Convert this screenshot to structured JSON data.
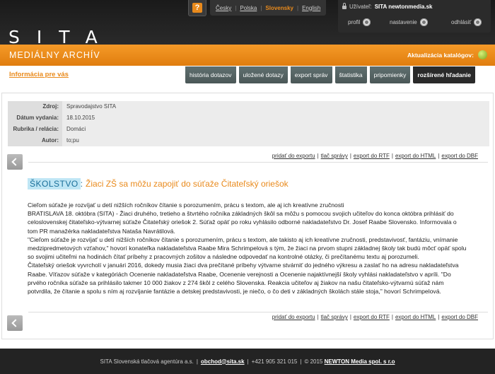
{
  "header": {
    "logo": "SITA",
    "help_label": "?",
    "languages": [
      {
        "label": "Česky",
        "active": false
      },
      {
        "label": "Polska",
        "active": false
      },
      {
        "label": "Slovensky",
        "active": true
      },
      {
        "label": "English",
        "active": false
      }
    ],
    "user_label": "Užívateľ:",
    "user_name": "SITA newtonmedia.sk",
    "profile_label": "profil",
    "settings_label": "nastavenie",
    "logout_label": "odhlásiť"
  },
  "banner": {
    "title": "MEDIÁLNY ARCHÍV",
    "update_label": "Aktualizácia katalógov:",
    "status_color": "#8fbc1f"
  },
  "info_link": "Informácia pre vás",
  "tabs": [
    {
      "label": "história dotazov"
    },
    {
      "label": "uložené dotazy"
    },
    {
      "label": "export správ"
    },
    {
      "label": "štatistika"
    },
    {
      "label": "pripomienky"
    },
    {
      "label": "rozšírené hľadanie",
      "active": true
    }
  ],
  "meta": [
    {
      "key": "Zdroj:",
      "value": "Spravodajstvo SITA"
    },
    {
      "key": "Dátum vydania:",
      "value": "18.10.2015"
    },
    {
      "key": "Rubrika / relácia:",
      "value": "Domáci"
    },
    {
      "key": "Autor:",
      "value": "to;pu"
    }
  ],
  "actions": {
    "add_export": "pridať do exportu",
    "print": "tlač správy",
    "export_rtf": "export do RTF",
    "export_html": "export do HTML",
    "export_dbf": "export do DBF"
  },
  "article": {
    "rubric": "ŠKOLSTVO",
    "colon": ":",
    "title": "Žiaci ZŠ sa môžu zapojiť do súťaže Čitateľský oriešok",
    "paragraphs": [
      "Cieľom súťaže je rozvíjať u detí nižších ročníkov čítanie s porozumením, prácu s textom, ale aj ich kreatívne zručnosti",
      "BRATISLAVA 18. októbra (SITA) - Žiaci druhého, tretieho a štvrtého ročníka základných škôl sa môžu s pomocou svojich učiteľov do konca októbra prihlásiť do celoslovenskej čitateľsko-výtvarnej súťaže Čitateľský oriešok 2. Súťaž opäť po roku vyhlásilo odborné nakladateľstvo Dr. Josef Raabe Slovensko. Informovala o tom PR manažérka nakladateľstva Nataša Navrátilová.",
      "\"Cieľom súťaže je rozvíjať u detí nižších ročníkov čítanie s porozumením, prácu s textom, ale takisto aj ich kreatívne zručnosti, predstavivosť, fantáziu, vnímanie medzipredmetových vzťahov,\" hovorí konateľka nakladateľstva Raabe Mira Schrimpelová s tým, že žiaci na prvom stupni základnej školy tak budú môcť opäť spolu so svojimi učiteľmi na hodinách čítať príbehy z pracovných zošitov a následne odpovedať na kontrolné otázky, či prečítanému textu aj porozumeli.",
      "Čitateľský oriešok vyvrcholí v januári 2016, dokedy musia žiaci dva prečítané príbehy výtvarne stvárniť do jedného výkresu a zaslať ho na adresu nakladateľstva Raabe. Víťazov súťaže v kategóriách Ocenenie nakladateľstva Raabe, Ocenenie verejnosti a Ocenenie najaktívnejší školy vyhlási nakladateľstvo v apríli. \"Do prvého ročníka súťaže sa prihlásilo takmer 10 000 žiakov z 274 škôl z celého Slovenska. Reakcia učiteľov aj žiakov na našu čitateľsko-výtvarnú súťaž nám potvrdila, že čítanie a spolu s ním aj rozvíjanie fantázie a detskej predstavivosti, je niečo, o čo deti v základných školách stále stoja,\" hovorí Schrimpelová."
    ]
  },
  "footer": {
    "company": "SITA Slovenská tlačová agentúra a.s.",
    "email": "obchod@sita.sk",
    "phone": "+421 905 321 015",
    "copyright": "© 2015",
    "partner": "NEWTON Media spol. s r.o"
  }
}
